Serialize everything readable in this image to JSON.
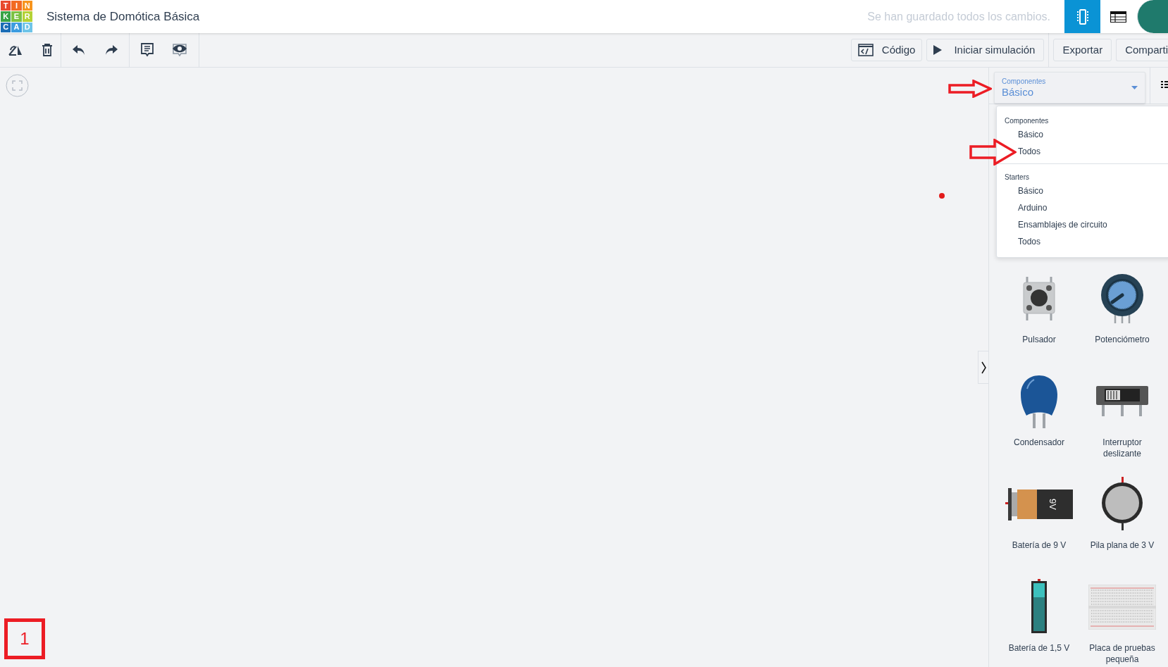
{
  "logo": {
    "rows": [
      [
        "T",
        "I",
        "N"
      ],
      [
        "K",
        "E",
        "R"
      ],
      [
        "C",
        "A",
        "D"
      ]
    ]
  },
  "header": {
    "title": "Sistema de Domótica Básica",
    "save_status": "Se han guardado todos los cambios."
  },
  "view_buttons": [
    {
      "kind": "circuit",
      "selected": true
    },
    {
      "kind": "table",
      "selected": false
    }
  ],
  "toolbar": {
    "actions": [
      "Código",
      "Iniciar simulación"
    ],
    "secondary": [
      "Exportar",
      "Comparti"
    ]
  },
  "components_select": {
    "label": "Componentes",
    "value": "Básico"
  },
  "dropdown_menu": [
    {
      "heading": "Componentes",
      "items": [
        "Básico",
        "Todos"
      ]
    },
    {
      "heading": "Starters",
      "items": [
        "Básico",
        "Arduino",
        "Ensamblajes de circuito",
        "Todos"
      ]
    }
  ],
  "components": [
    {
      "kind": "pushbutton",
      "label": "Pulsador"
    },
    {
      "kind": "potentiometer",
      "label": "Potenciómetro"
    },
    {
      "kind": "capacitor",
      "label": "Condensador"
    },
    {
      "kind": "slideswitch",
      "label": "Interruptor deslizante"
    },
    {
      "kind": "battery9v",
      "label": "Batería de 9 V",
      "marking": [
        "9V"
      ]
    },
    {
      "kind": "coincell",
      "label": "Pila plana de 3 V"
    },
    {
      "kind": "aa",
      "label": "Batería de 1,5 V"
    },
    {
      "kind": "breadboard",
      "label": "Placa de pruebas pequeña"
    }
  ],
  "annotation": {
    "step": "1"
  }
}
